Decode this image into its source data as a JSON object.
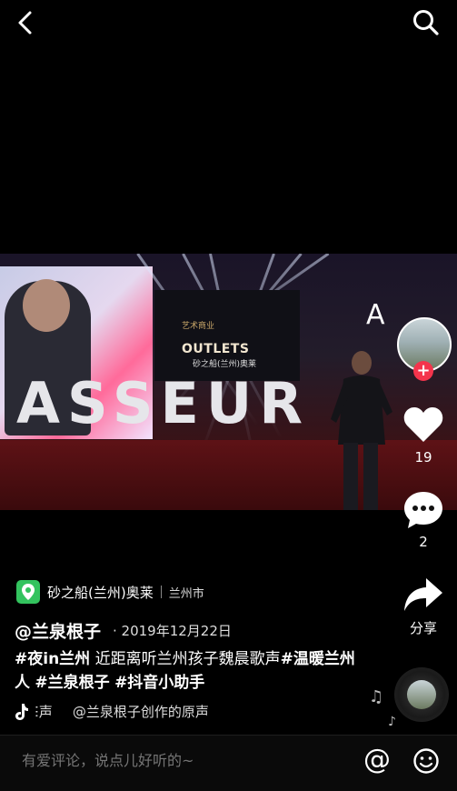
{
  "nav": {
    "back_icon": "chevron-left-icon",
    "search_icon": "search-icon"
  },
  "video": {
    "sign_text": "OUTLETS",
    "sign_sub": "砂之船(兰州)奥莱",
    "logo_text": "艺术商业",
    "big_letters": "ASSEUR",
    "overlay_letter": "A"
  },
  "rail": {
    "like_count": "19",
    "comment_count": "2",
    "share_label": "分享",
    "follow_symbol": "+"
  },
  "location": {
    "name": "砂之船(兰州)奥莱",
    "city": "兰州市"
  },
  "post": {
    "author": "@兰泉根子",
    "date": "· 2019年12月22日",
    "caption_parts": [
      "#夜in兰州",
      " 近距离听兰州孩子魏晨歌声",
      "#温暖兰州人",
      " ",
      "#兰泉根子",
      " ",
      "#抖音小助手"
    ]
  },
  "music": {
    "left_text": "ⵗ声",
    "right_text": "@兰泉根子创作的原声"
  },
  "bottom": {
    "placeholder": "有爱评论，说点儿好听的~",
    "at_symbol": "@"
  },
  "colors": {
    "like": "#ffffff",
    "follow": "#f4344c",
    "location_pin": "#33c35e"
  }
}
